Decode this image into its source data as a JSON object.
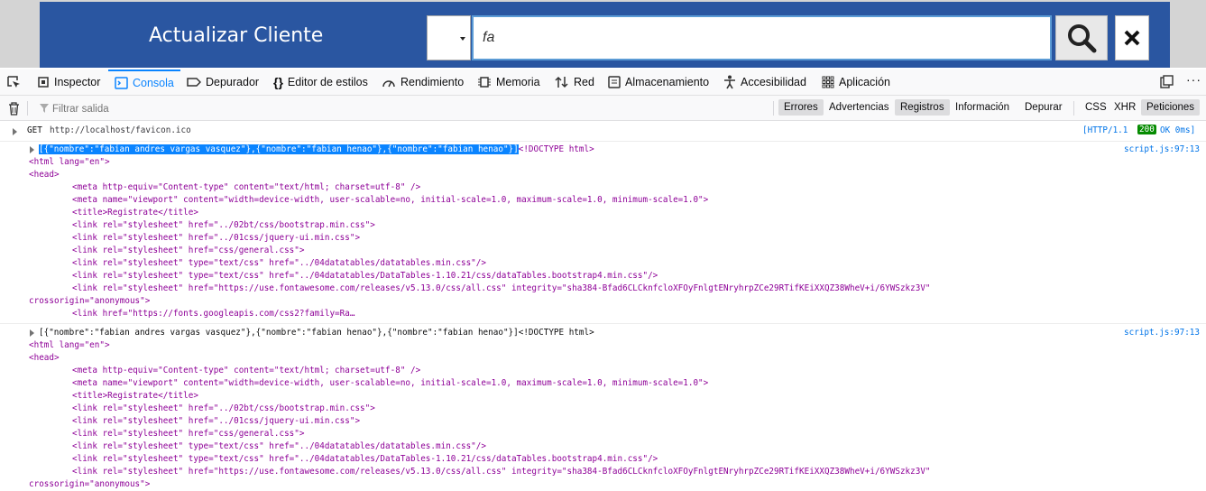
{
  "app": {
    "title": "Actualizar Cliente",
    "search_value": "fa",
    "search_icon": "magnifier-icon",
    "close_icon": "close-x-icon"
  },
  "devtools": {
    "tabs": [
      {
        "label": "Inspector",
        "icon": "inspector-icon"
      },
      {
        "label": "Consola",
        "icon": "console-icon",
        "active": true
      },
      {
        "label": "Depurador",
        "icon": "debugger-icon"
      },
      {
        "label": "Editor de estilos",
        "icon": "braces-icon"
      },
      {
        "label": "Rendimiento",
        "icon": "gauge-icon"
      },
      {
        "label": "Memoria",
        "icon": "memory-chip-icon"
      },
      {
        "label": "Red",
        "icon": "network-arrows-icon"
      },
      {
        "label": "Almacenamiento",
        "icon": "storage-icon"
      },
      {
        "label": "Accesibilidad",
        "icon": "accessibility-icon"
      },
      {
        "label": "Aplicación",
        "icon": "grid-icon"
      }
    ],
    "filter_placeholder": "Filtrar salida",
    "filters": [
      "Errores",
      "Advertencias",
      "Registros",
      "Información",
      "Depurar"
    ],
    "net_filters": [
      "CSS",
      "XHR",
      "Peticiones"
    ],
    "accent": "#0a84ff"
  },
  "console": {
    "net_request": {
      "method": "GET",
      "url": "http://localhost/favicon.ico",
      "protocol": "[HTTP/1.1",
      "status": "200",
      "result": "OK 0ms]"
    },
    "entry1": {
      "location": "script.js:97:13",
      "selected_json": "[{\"nombre\":\"fabian andres vargas vasquez\"},{\"nombre\":\"fabian henao\"},{\"nombre\":\"fabian henao\"}]",
      "lines": [
        "<!DOCTYPE html>",
        "<html lang=\"en\">",
        "<head>",
        "<meta http-equiv=\"Content-type\" content=\"text/html; charset=utf-8\" />",
        "<meta name=\"viewport\" content=\"width=device-width, user-scalable=no, initial-scale=1.0, maximum-scale=1.0, minimum-scale=1.0\">",
        "<title>Registrate</title>",
        "<link rel=\"stylesheet\" href=\"../02bt/css/bootstrap.min.css\">",
        "<link rel=\"stylesheet\" href=\"../01css/jquery-ui.min.css\">",
        "<link rel=\"stylesheet\" href=\"css/general.css\">",
        "<link rel=\"stylesheet\" type=\"text/css\" href=\"../04datatables/datatables.min.css\"/>",
        "<link rel=\"stylesheet\" type=\"text/css\" href=\"../04datatables/DataTables-1.10.21/css/dataTables.bootstrap4.min.css\"/>",
        "<link rel=\"stylesheet\" href=\"https://use.fontawesome.com/releases/v5.13.0/css/all.css\" integrity=\"sha384-Bfad6CLCknfcloXFOyFnlgtENryhrpZCe29RTifKEiXXQZ38WheV+i/6YWSzkz3V\"",
        "crossorigin=\"anonymous\">",
        "<link href=\"https://fonts.googleapis.com/css2?family=Ra…"
      ]
    },
    "entry2": {
      "location": "script.js:97:13",
      "first_line": "[{\"nombre\":\"fabian andres vargas vasquez\"},{\"nombre\":\"fabian henao\"},{\"nombre\":\"fabian henao\"}]<!DOCTYPE html>",
      "lines": [
        "<html lang=\"en\">",
        "<head>",
        "<meta http-equiv=\"Content-type\" content=\"text/html; charset=utf-8\" />",
        "<meta name=\"viewport\" content=\"width=device-width, user-scalable=no, initial-scale=1.0, maximum-scale=1.0, minimum-scale=1.0\">",
        "<title>Registrate</title>",
        "<link rel=\"stylesheet\" href=\"../02bt/css/bootstrap.min.css\">",
        "<link rel=\"stylesheet\" href=\"../01css/jquery-ui.min.css\">",
        "<link rel=\"stylesheet\" href=\"css/general.css\">",
        "<link rel=\"stylesheet\" type=\"text/css\" href=\"../04datatables/datatables.min.css\"/>",
        "<link rel=\"stylesheet\" type=\"text/css\" href=\"../04datatables/DataTables-1.10.21/css/dataTables.bootstrap4.min.css\"/>",
        "<link rel=\"stylesheet\" href=\"https://use.fontawesome.com/releases/v5.13.0/css/all.css\" integrity=\"sha384-Bfad6CLCknfcloXFOyFnlgtENryhrpZCe29RTifKEiXXQZ38WheV+i/6YWSzkz3V\"",
        "crossorigin=\"anonymous\">"
      ]
    }
  }
}
